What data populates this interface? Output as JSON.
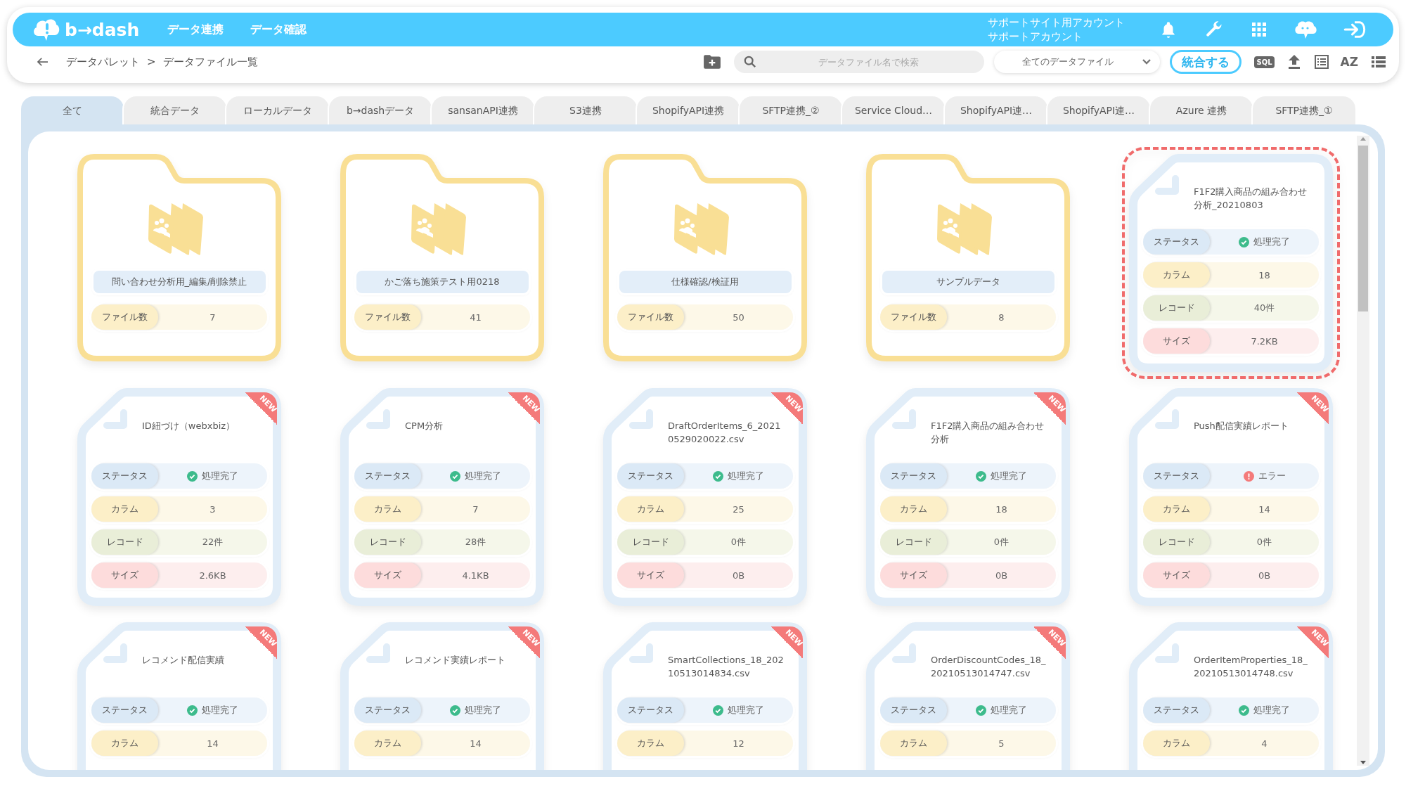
{
  "header": {
    "logo": "b→dash",
    "nav": [
      {
        "label": "データ連携"
      },
      {
        "label": "データ確認"
      }
    ],
    "account": [
      "サポートサイト用アカウント",
      "サポートアカウント"
    ]
  },
  "toolbar": {
    "breadcrumb": [
      "データパレット",
      ">",
      "データファイル一覧"
    ],
    "search": {
      "placeholder": "データファイル名で検索"
    },
    "filter": {
      "value": "全てのデータファイル"
    },
    "merge_button": "統合する",
    "sql_button": "SQL",
    "sort_button": "AZ"
  },
  "tabs": [
    {
      "label": "全て",
      "selected": true
    },
    {
      "label": "統合データ",
      "selected": false
    },
    {
      "label": "ローカルデータ",
      "selected": false
    },
    {
      "label": "b→dashデータ",
      "selected": false
    },
    {
      "label": "sansanAPI連携",
      "selected": false
    },
    {
      "label": "S3連携",
      "selected": false
    },
    {
      "label": "ShopifyAPI連携",
      "selected": false
    },
    {
      "label": "SFTP連携_②",
      "selected": false
    },
    {
      "label": "Service Cloud…",
      "selected": false
    },
    {
      "label": "ShopifyAPI連…",
      "selected": false
    },
    {
      "label": "ShopifyAPI連…",
      "selected": false
    },
    {
      "label": "Azure 連携",
      "selected": false
    },
    {
      "label": "SFTP連携_①",
      "selected": false
    }
  ],
  "items": [
    {
      "kind": "folder",
      "name": "問い合わせ分析用_編集/削除禁止",
      "count_label": "ファイル数",
      "count": "7"
    },
    {
      "kind": "folder",
      "name": "かご落ち施策テスト用0218",
      "count_label": "ファイル数",
      "count": "41"
    },
    {
      "kind": "folder",
      "name": "仕様確認/検証用",
      "count_label": "ファイル数",
      "count": "50"
    },
    {
      "kind": "folder",
      "name": "サンプルデータ",
      "count_label": "ファイル数",
      "count": "8"
    },
    {
      "kind": "file",
      "name": "F1F2購入商品の組み合わせ分析_20210803",
      "selected": true,
      "stats": [
        {
          "kind": "status",
          "label": "ステータス",
          "value": "処理完了",
          "error": false
        },
        {
          "kind": "column",
          "label": "カラム",
          "value": "18"
        },
        {
          "kind": "record",
          "label": "レコード",
          "value": "40件"
        },
        {
          "kind": "size",
          "label": "サイズ",
          "value": "7.2KB"
        }
      ]
    },
    {
      "kind": "file",
      "name": "ID紐づけ（webxbiz）",
      "badge": "NEW",
      "selected": false,
      "stats": [
        {
          "kind": "status",
          "label": "ステータス",
          "value": "処理完了",
          "error": false
        },
        {
          "kind": "column",
          "label": "カラム",
          "value": "3"
        },
        {
          "kind": "record",
          "label": "レコード",
          "value": "22件"
        },
        {
          "kind": "size",
          "label": "サイズ",
          "value": "2.6KB"
        }
      ]
    },
    {
      "kind": "file",
      "name": "CPM分析",
      "badge": "NEW",
      "selected": false,
      "stats": [
        {
          "kind": "status",
          "label": "ステータス",
          "value": "処理完了",
          "error": false
        },
        {
          "kind": "column",
          "label": "カラム",
          "value": "7"
        },
        {
          "kind": "record",
          "label": "レコード",
          "value": "28件"
        },
        {
          "kind": "size",
          "label": "サイズ",
          "value": "4.1KB"
        }
      ]
    },
    {
      "kind": "file",
      "name": "DraftOrderItems_6_20210529020022.csv",
      "badge": "NEW",
      "selected": false,
      "stats": [
        {
          "kind": "status",
          "label": "ステータス",
          "value": "処理完了",
          "error": false
        },
        {
          "kind": "column",
          "label": "カラム",
          "value": "25"
        },
        {
          "kind": "record",
          "label": "レコード",
          "value": "0件"
        },
        {
          "kind": "size",
          "label": "サイズ",
          "value": "0B"
        }
      ]
    },
    {
      "kind": "file",
      "name": "F1F2購入商品の組み合わせ分析",
      "badge": "NEW",
      "selected": false,
      "stats": [
        {
          "kind": "status",
          "label": "ステータス",
          "value": "処理完了",
          "error": false
        },
        {
          "kind": "column",
          "label": "カラム",
          "value": "18"
        },
        {
          "kind": "record",
          "label": "レコード",
          "value": "0件"
        },
        {
          "kind": "size",
          "label": "サイズ",
          "value": "0B"
        }
      ]
    },
    {
      "kind": "file",
      "name": "Push配信実績レポート",
      "badge": "NEW",
      "selected": false,
      "stats": [
        {
          "kind": "status",
          "label": "ステータス",
          "value": "エラー",
          "error": true
        },
        {
          "kind": "column",
          "label": "カラム",
          "value": "14"
        },
        {
          "kind": "record",
          "label": "レコード",
          "value": "0件"
        },
        {
          "kind": "size",
          "label": "サイズ",
          "value": "0B"
        }
      ]
    },
    {
      "kind": "file",
      "name": "レコメンド配信実績",
      "badge": "NEW",
      "selected": false,
      "stats": [
        {
          "kind": "status",
          "label": "ステータス",
          "value": "処理完了",
          "error": false
        },
        {
          "kind": "column",
          "label": "カラム",
          "value": "14"
        }
      ]
    },
    {
      "kind": "file",
      "name": "レコメンド実績レポート",
      "badge": "NEW",
      "selected": false,
      "stats": [
        {
          "kind": "status",
          "label": "ステータス",
          "value": "処理完了",
          "error": false
        },
        {
          "kind": "column",
          "label": "カラム",
          "value": "14"
        }
      ]
    },
    {
      "kind": "file",
      "name": "SmartCollections_18_20210513014834.csv",
      "badge": "NEW",
      "selected": false,
      "stats": [
        {
          "kind": "status",
          "label": "ステータス",
          "value": "処理完了",
          "error": false
        },
        {
          "kind": "column",
          "label": "カラム",
          "value": "12"
        }
      ]
    },
    {
      "kind": "file",
      "name": "OrderDiscountCodes_18_20210513014747.csv",
      "badge": "NEW",
      "selected": false,
      "stats": [
        {
          "kind": "status",
          "label": "ステータス",
          "value": "処理完了",
          "error": false
        },
        {
          "kind": "column",
          "label": "カラム",
          "value": "5"
        }
      ]
    },
    {
      "kind": "file",
      "name": "OrderItemProperties_18_20210513014748.csv",
      "badge": "NEW",
      "selected": false,
      "stats": [
        {
          "kind": "status",
          "label": "ステータス",
          "value": "処理完了",
          "error": false
        },
        {
          "kind": "column",
          "label": "カラム",
          "value": "4"
        }
      ]
    }
  ]
}
